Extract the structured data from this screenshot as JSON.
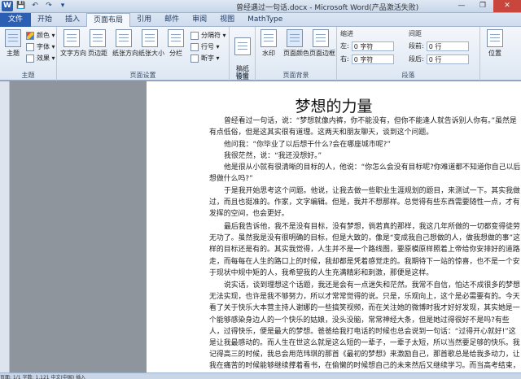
{
  "titlebar": {
    "title": "曾经遇过一句话.docx - Microsoft Word(产品激活失败)",
    "quick_access": [
      "W",
      "💾",
      "↶",
      "↷",
      "▾"
    ],
    "controls": [
      "—",
      "❐",
      "✕"
    ]
  },
  "tabs": [
    "文件",
    "开始",
    "插入",
    "页面布局",
    "引用",
    "邮件",
    "审阅",
    "视图",
    "MathType"
  ],
  "active_tab": "页面布局",
  "ribbon": {
    "theme_group": {
      "label": "主题",
      "main_button": "主题",
      "items": [
        "颜色 ▾",
        "字体 ▾",
        "效果 ▾"
      ]
    },
    "page_setup_group": {
      "label": "页面设置",
      "buttons": [
        "文字方向",
        "页边距",
        "纸张方向",
        "纸张大小",
        "分栏"
      ],
      "items": [
        "分隔符 ▾",
        "行号 ▾",
        "断字 ▾"
      ]
    },
    "draft_group": {
      "label": "稿纸",
      "button": "稿纸\n设置"
    },
    "page_background_group": {
      "label": "页面背景",
      "buttons": [
        "水印",
        "页面颜色",
        "页面边框"
      ]
    },
    "paragraph_group": {
      "label": "段落",
      "indent_label": "缩进",
      "left_label": "左:",
      "right_label": "右:",
      "left_value": "0 字符",
      "right_value": "0 字符",
      "spacing_label": "间距",
      "before_label": "段前:",
      "after_label": "段后:",
      "before_value": "0 行",
      "after_value": "0 行"
    },
    "arrange_group": {
      "button": "位置"
    }
  },
  "document": {
    "title": "梦想的力量",
    "paragraphs": [
      "曾经看过一句话，说：“梦想就像内裤，你不能没有，但你不能逢人就告诉别人你有。”虽然是有点低俗，但是这其实很有道理。这两天和朋友聊天，谈到这个问题。",
      "他问我：“你毕业了以后想干什么?会在哪座城市呢?”",
      "我很茫然，说：“我还没想好。”",
      "他是很从小就有很清晰的目标的人，他说：“你怎么会没有目标呢?你难道都不知道你自己以后想做什么吗?”",
      "于是我开始思考这个问题。他说，让我去做一些职业生涯规划的题目，来测试一下。其实我做过，而且也挺准的。作家，文字编辑。但是，我并不想那样。总觉得有些东西需要随性一点，才有发挥的空间，也会更好。",
      "最后我告诉他，我不是没有目标，没有梦想，倘若真的那样，我这几年所做的一切都变得徒劳无功了。虽然我是没有很明确的目标，但是大致的，像是“变成我自己想做的人，做我想做的事”这样的目标还是有的。其实我觉得，人生并不是一个路线图，要原模原样照着上帝给你安排好的道路走，而每每在人生的路口上的时候，我却都是凭着感觉走的。我期待下一站的惊喜，也不是一个安于现状中规中矩的人，我希望我的人生充满精彩和刺激，那便是这样。",
      "说实话，谈到理想这个话题，我还是会有一点迷失和茫然。我常不自信，怕达不成很多的梦想无法实现，也许是我不够努力，所以才常常觉得的说。只是，乐观向上，这个是必需要有的。今天看了关于快乐大本营主持人谢娜的一些搞笑视频，而在关注她的微博时我才好好发现，其实她是一个能够感染身边人的一个快乐的姑娘，没头没脑，常常神经大条，但是她过得很好不是吗?有些人，过得快乐，便是最大的梦想。爸爸给我打电话的时候也总会说到一句话：“过得开心就好!”这是让我最感动的。而人生在世这么就是这么短的一辈子，一辈子太短，所以当然要足够的快乐。我记得高三的时候，我总会用范玮琪的那首《最初的梦想》来激励自己，那首歌总是给我多动力，让我在痛苦的时候能够继续撑着看书，在偷懒的时候想自己的未来然后又继续学习。而当高考结束，一切都松懈下来了之后，感觉一下子就放"
    ]
  },
  "statusbar": {
    "text": "页面: 1/1   字数: 1,121   中文(中国)   插入"
  }
}
